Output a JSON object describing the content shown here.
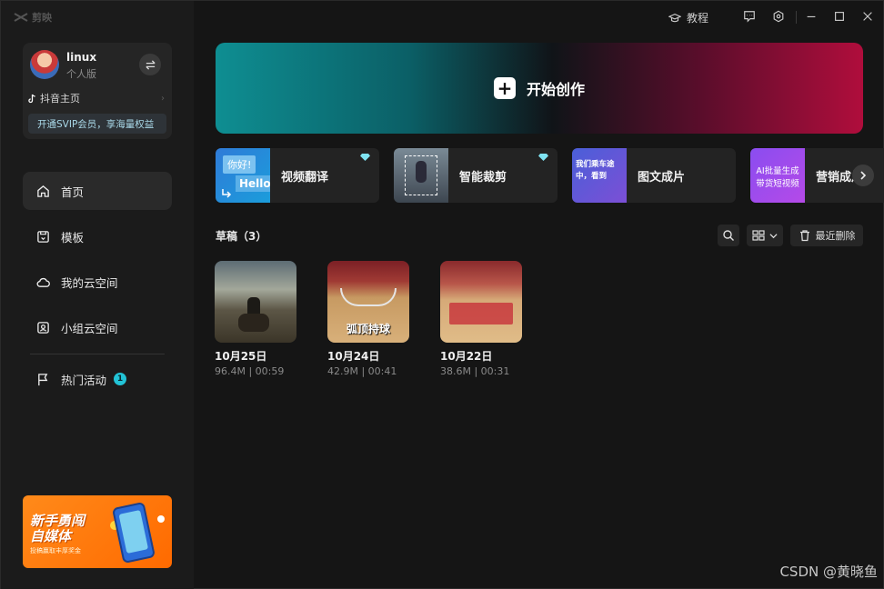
{
  "app": {
    "name": "剪映"
  },
  "titlebar": {
    "tutorial_label": "教程"
  },
  "profile": {
    "username": "linux",
    "edition": "个人版",
    "douyin_label": "抖音主页",
    "svip_label": "开通SVIP会员，享海量权益"
  },
  "nav": {
    "home": "首页",
    "templates": "模板",
    "my_cloud": "我的云空间",
    "team_cloud": "小组云空间",
    "events": "热门活动",
    "events_badge": "1"
  },
  "promo": {
    "title_line1": "新手勇闯",
    "title_line2": "自媒体",
    "subtitle": "投稿赢取丰厚奖金"
  },
  "create": {
    "label": "开始创作"
  },
  "tools": [
    {
      "label": "视频翻译",
      "thumb_text_1": "你好!",
      "thumb_text_2": "Hello"
    },
    {
      "label": "智能裁剪"
    },
    {
      "label": "图文成片",
      "thumb_text_1": "我们乘车途中，看到"
    },
    {
      "label": "营销成片",
      "thumb_text_1": "AI批量生成",
      "thumb_text_2": "带货短视频"
    }
  ],
  "drafts": {
    "header": "草稿（3）",
    "recent_delete_label": "最近删除",
    "items": [
      {
        "date": "10月25日",
        "meta": "96.4M | 00:59",
        "overlay": ""
      },
      {
        "date": "10月24日",
        "meta": "42.9M | 00:41",
        "overlay": "弧顶持球"
      },
      {
        "date": "10月22日",
        "meta": "38.6M | 00:31",
        "overlay": ""
      }
    ]
  },
  "watermark": "CSDN @黄晓鱼",
  "colors": {
    "accent": "#22c3d6",
    "banner_left": "#0e8e92",
    "banner_right": "#b00d3c",
    "promo": "#ff7a0f"
  }
}
